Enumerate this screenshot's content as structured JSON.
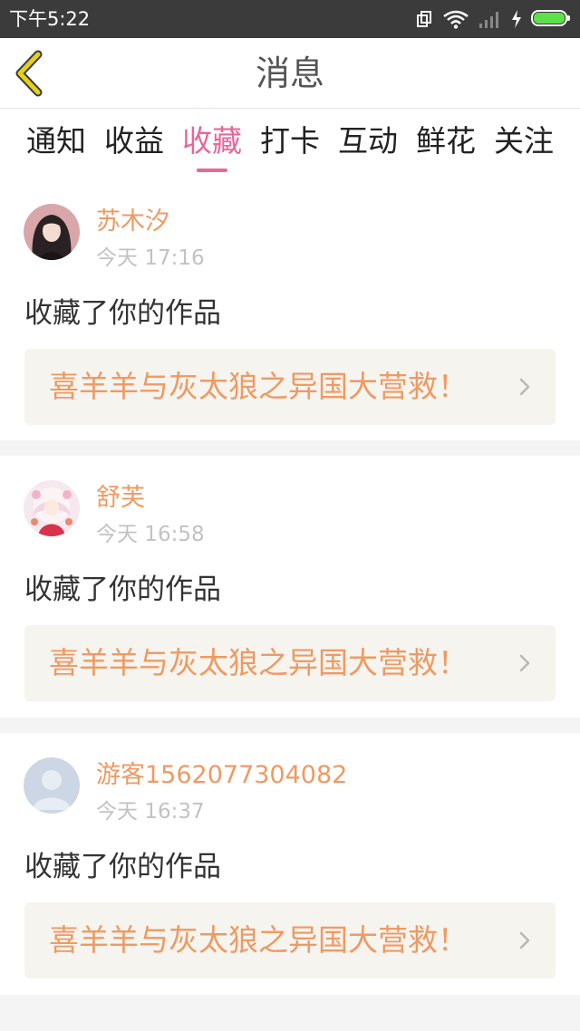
{
  "status_bar": {
    "time": "下午5:22",
    "battery_level": 1.0,
    "colors": {
      "background": "#3b3b3b",
      "battery": "#5de04a"
    }
  },
  "header": {
    "title": "消息",
    "back_icon": "chevron-left-icon",
    "colors": {
      "back_icon": "#e6d01a"
    }
  },
  "tabs": {
    "items": [
      "通知",
      "收益",
      "收藏",
      "打卡",
      "互动",
      "鲜花",
      "关注"
    ],
    "active_index": 2,
    "colors": {
      "active": "#e8669a",
      "inactive": "#222222"
    }
  },
  "messages": [
    {
      "user": "苏木汐",
      "time": "今天 17:16",
      "action": "收藏了你的作品",
      "work": "喜羊羊与灰太狼之异国大营救！",
      "avatar_icon": "user-avatar-girl"
    },
    {
      "user": "舒芙",
      "time": "今天 16:58",
      "action": "收藏了你的作品",
      "work": "喜羊羊与灰太狼之异国大营救！",
      "avatar_icon": "user-avatar-anime"
    },
    {
      "user": "游客1562077304082",
      "time": "今天 16:37",
      "action": "收藏了你的作品",
      "work": "喜羊羊与灰太狼之异国大营救！",
      "avatar_icon": "default-avatar-icon"
    }
  ],
  "colors": {
    "accent_name": "#ef9a62",
    "timestamp": "#c2c2c2",
    "work_box": "#f5f4ef",
    "separator": "#f4f4f4"
  }
}
